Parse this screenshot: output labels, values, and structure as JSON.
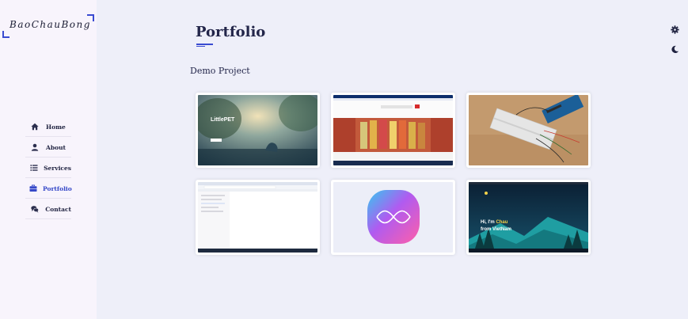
{
  "brand": {
    "logo_text": "BaoChauBong"
  },
  "nav": {
    "items": [
      {
        "label": "Home",
        "icon": "home-icon",
        "active": false
      },
      {
        "label": "About",
        "icon": "user-icon",
        "active": false
      },
      {
        "label": "Services",
        "icon": "list-icon",
        "active": false
      },
      {
        "label": "Portfolio",
        "icon": "briefcase-icon",
        "active": true
      },
      {
        "label": "Contact",
        "icon": "comments-icon",
        "active": false
      }
    ]
  },
  "page": {
    "title": "Portfolio",
    "section_title": "Demo Project"
  },
  "controls": {
    "settings_icon": "gear-icon",
    "theme_icon": "moon-icon"
  },
  "projects": [
    {
      "name": "littlepet",
      "headline": "LittlePET"
    },
    {
      "name": "movie-site"
    },
    {
      "name": "arduino-breadboard"
    },
    {
      "name": "file-manager"
    },
    {
      "name": "app-logo"
    },
    {
      "name": "personal-homepage",
      "greeting_1": "Hi, I'm",
      "greeting_name": "Chau",
      "greeting_2": "from VietNam"
    }
  ],
  "colors": {
    "accent": "#3a4bd1",
    "sidebar_bg": "#f8f4fc",
    "main_bg": "#eeeff9"
  }
}
